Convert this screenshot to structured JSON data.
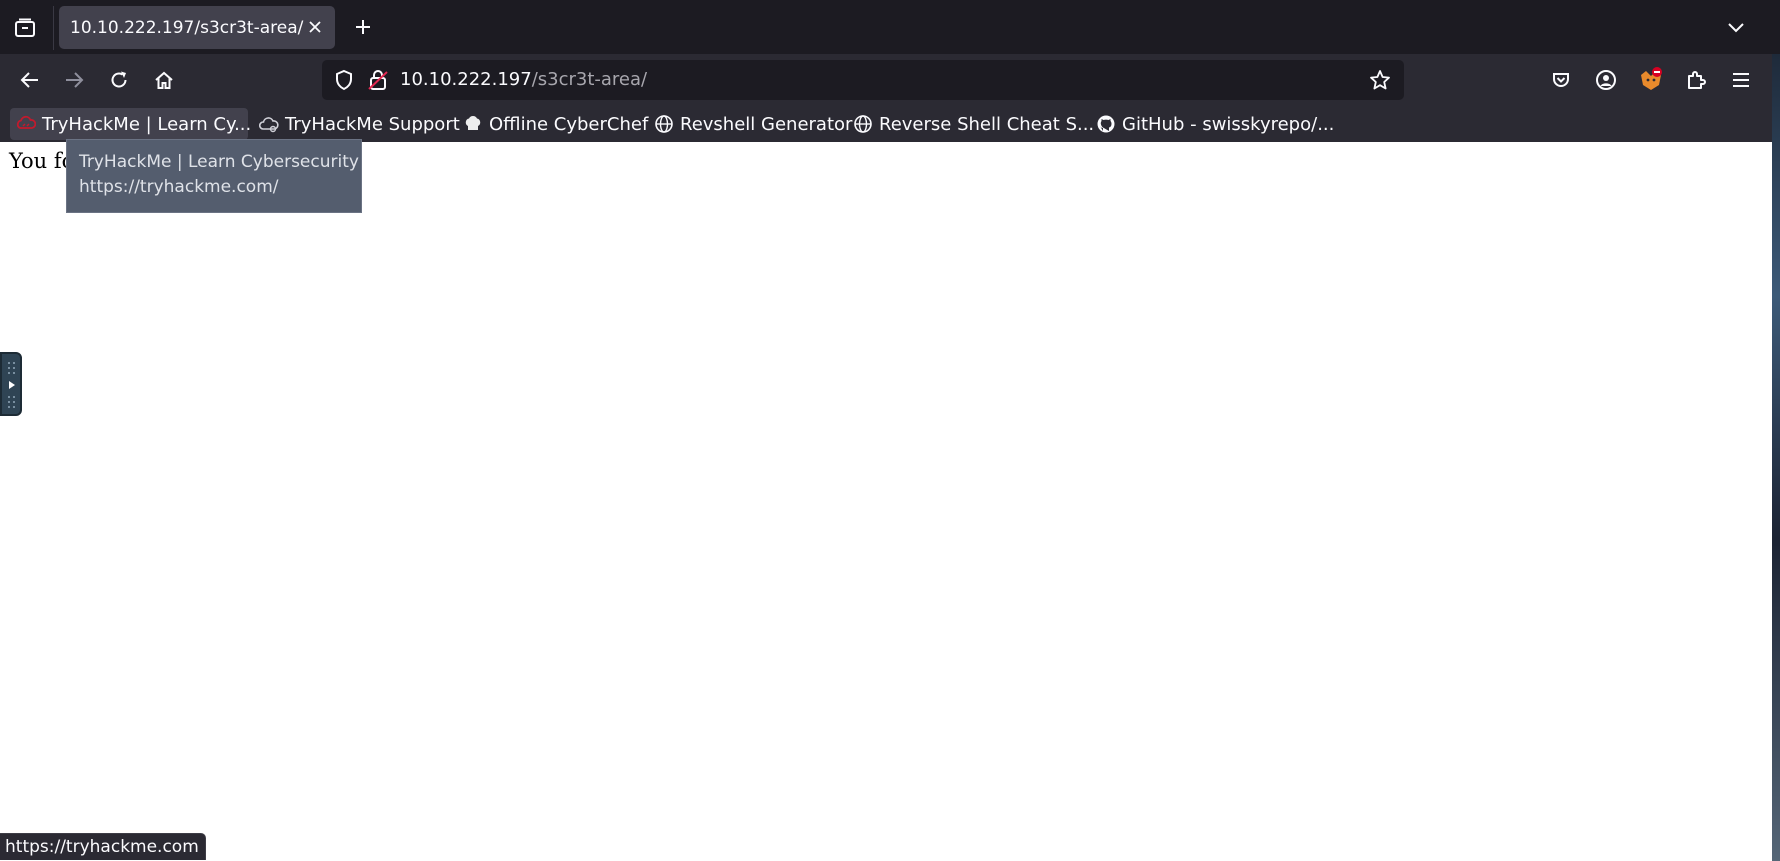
{
  "browser": {
    "tab": {
      "title": "10.10.222.197/s3cr3t-area/"
    },
    "url": {
      "host": "10.10.222.197",
      "path": "/s3cr3t-area/"
    },
    "bookmarks": [
      {
        "label": "TryHackMe | Learn Cy...",
        "icon": "tryhackme-icon"
      },
      {
        "label": "TryHackMe Support",
        "icon": "cloud-icon"
      },
      {
        "label": "Offline CyberChef",
        "icon": "chef-hat-icon"
      },
      {
        "label": "Revshell Generator",
        "icon": "globe-icon"
      },
      {
        "label": "Reverse Shell Cheat S...",
        "icon": "globe-icon"
      },
      {
        "label": "GitHub - swisskyrepo/...",
        "icon": "github-icon"
      }
    ],
    "tooltip": {
      "title": "TryHackMe | Learn Cybersecurity",
      "url": "https://tryhackme.com/"
    },
    "status_url": "https://tryhackme.com",
    "colors": {
      "chrome": "#2b2a33",
      "tabstrip": "#1c1b22",
      "tooltip": "#545d6e"
    }
  },
  "page": {
    "text": "You fo"
  }
}
